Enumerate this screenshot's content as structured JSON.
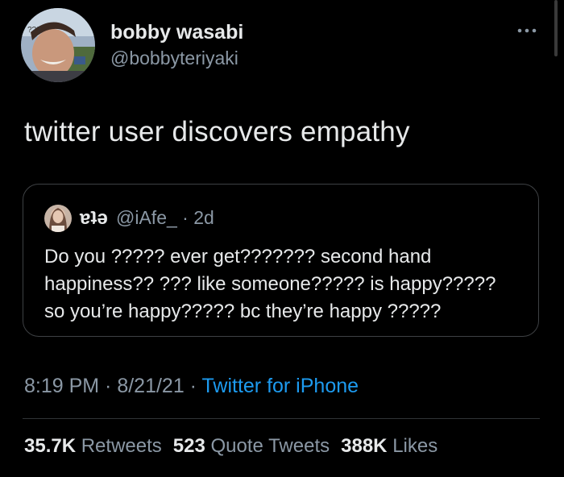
{
  "tweet": {
    "author": {
      "display_name": "bobby wasabi",
      "handle": "@bobbyteriyaki",
      "avatar_caption": "???"
    },
    "text": "twitter user discovers empathy",
    "more_icon": "more-horizontal-icon",
    "quoted": {
      "display_name": "ɐʇǝ",
      "handle_time": "@iAfe_ · 2d",
      "lines": [
        "Do you ????? ever get??????? second hand",
        "happiness?? ??? like someone????? is happy?????",
        "so you’re happy????? bc they’re happy ?????"
      ]
    },
    "meta": {
      "timestamp": "8:19 PM · 8/21/21 · ",
      "source": "Twitter for iPhone"
    },
    "stats": {
      "retweets_count": "35.7K",
      "retweets_label": "Retweets",
      "quotes_count": "523",
      "quotes_label": "Quote Tweets",
      "likes_count": "388K",
      "likes_label": "Likes"
    }
  },
  "colors": {
    "background": "#000000",
    "text_primary": "#e7e9ea",
    "text_secondary": "#8b98a5",
    "link": "#1d9bf0",
    "border": "#3e4144"
  }
}
